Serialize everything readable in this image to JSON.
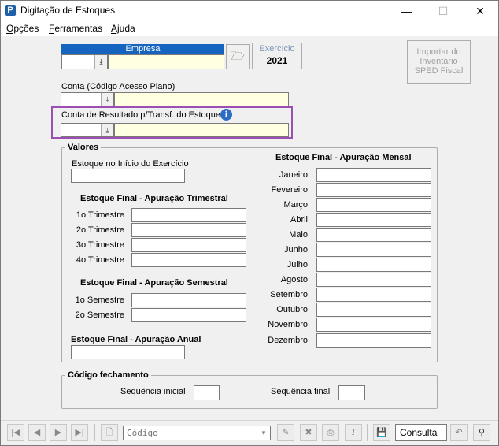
{
  "window": {
    "title": "Digitação de Estoques",
    "app_icon": "P",
    "minimize_glyph": "—",
    "maximize_glyph": "☐",
    "close_glyph": "✕"
  },
  "menu": [
    "Opções",
    "Ferramentas",
    "Ajuda"
  ],
  "empresa": {
    "label": "Empresa",
    "code_value": "",
    "name_value": ""
  },
  "exercicio": {
    "label": "Exercício",
    "value": "2021"
  },
  "import_button": {
    "line1": "Importar do",
    "line2": "Inventário",
    "line3": "SPED Fiscal"
  },
  "conta": {
    "label": "Conta (Código Acesso Plano)",
    "code_value": "",
    "desc_value": ""
  },
  "conta_resultado": {
    "label": "Conta de Resultado p/Transf. do Estoque",
    "info_glyph": "i",
    "code_value": "",
    "desc_value": ""
  },
  "valores": {
    "title": "Valores",
    "inicio_label": "Estoque no Início do Exercício",
    "trimestral": {
      "title": "Estoque Final - Apuração Trimestral",
      "rows": [
        "1o Trimestre",
        "2o Trimestre",
        "3o Trimestre",
        "4o Trimestre"
      ]
    },
    "semestral": {
      "title": "Estoque Final - Apuração Semestral",
      "rows": [
        "1o Semestre",
        "2o Semestre"
      ]
    },
    "anual": {
      "title": "Estoque Final - Apuração Anual"
    },
    "mensal": {
      "title": "Estoque Final - Apuração Mensal",
      "rows": [
        "Janeiro",
        "Fevereiro",
        "Março",
        "Abril",
        "Maio",
        "Junho",
        "Julho",
        "Agosto",
        "Setembro",
        "Outubro",
        "Novembro",
        "Dezembro"
      ]
    }
  },
  "codigo_fechamento": {
    "title": "Código fechamento",
    "seq_inicial_label": "Sequência inicial",
    "seq_final_label": "Sequência final"
  },
  "toolbar": {
    "nav": [
      "|◀",
      "◀",
      "▶",
      "▶|"
    ],
    "search_placeholder": "Código",
    "mode_label": "Consulta",
    "tools": [
      "🗋",
      "✎",
      "⎙",
      "I",
      "💾",
      "↶",
      "⚲"
    ]
  }
}
